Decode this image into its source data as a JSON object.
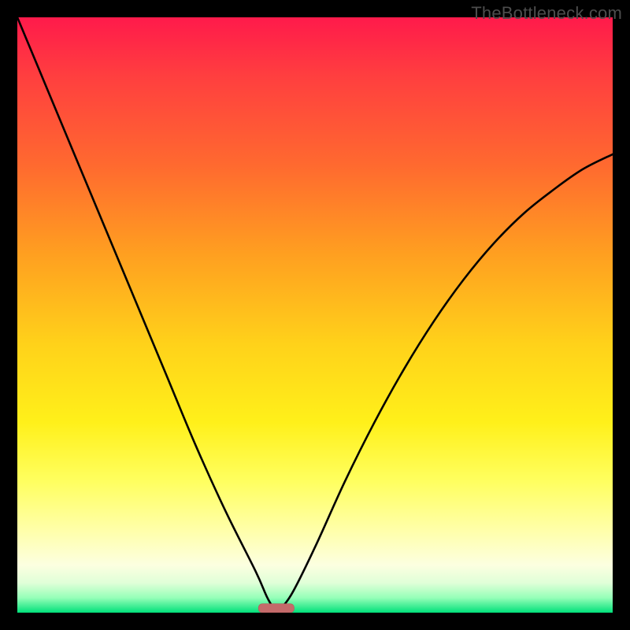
{
  "watermark": "TheBottleneck.com",
  "chart_data": {
    "type": "line",
    "title": "",
    "xlabel": "",
    "ylabel": "",
    "xlim": [
      0,
      100
    ],
    "ylim": [
      0,
      100
    ],
    "optimal_x": 43.5,
    "marker": {
      "x": 43.5,
      "y": 0,
      "width": 6,
      "height": 1.5,
      "color": "#c46a6a"
    },
    "series": [
      {
        "name": "left-curve",
        "x": [
          0,
          5,
          10,
          15,
          20,
          25,
          30,
          35,
          40,
          42,
          43.5
        ],
        "values": [
          100,
          88,
          76,
          64,
          52,
          40,
          28,
          17,
          7,
          2.5,
          0
        ]
      },
      {
        "name": "right-curve",
        "x": [
          43.5,
          46,
          50,
          55,
          60,
          65,
          70,
          75,
          80,
          85,
          90,
          95,
          100
        ],
        "values": [
          0,
          3,
          11,
          22,
          32,
          41,
          49,
          56,
          62,
          67,
          71,
          74.5,
          77
        ]
      }
    ],
    "background_gradient": {
      "stops": [
        {
          "pos": 0,
          "color": "#ff1a4b"
        },
        {
          "pos": 55,
          "color": "#ffd21a"
        },
        {
          "pos": 100,
          "color": "#00e07a"
        }
      ]
    }
  }
}
